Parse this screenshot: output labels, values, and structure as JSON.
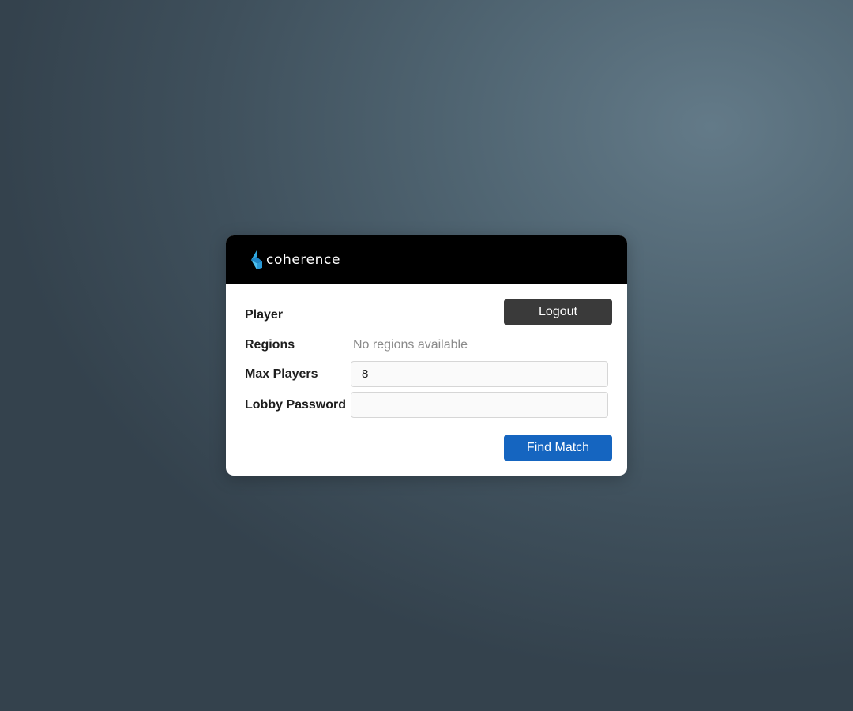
{
  "app": {
    "logo_text": "coherence",
    "logo_icon": "coherence-logo-icon",
    "accent_color": "#2fa8e0"
  },
  "form": {
    "player_label": "Player",
    "regions_label": "Regions",
    "regions_value": "No regions available",
    "max_players_label": "Max Players",
    "max_players_value": "8",
    "lobby_password_label": "Lobby Password",
    "lobby_password_value": ""
  },
  "buttons": {
    "logout_label": "Logout",
    "logout_color": "#3a3a3a",
    "find_match_label": "Find Match",
    "find_match_color": "#1565c0"
  }
}
